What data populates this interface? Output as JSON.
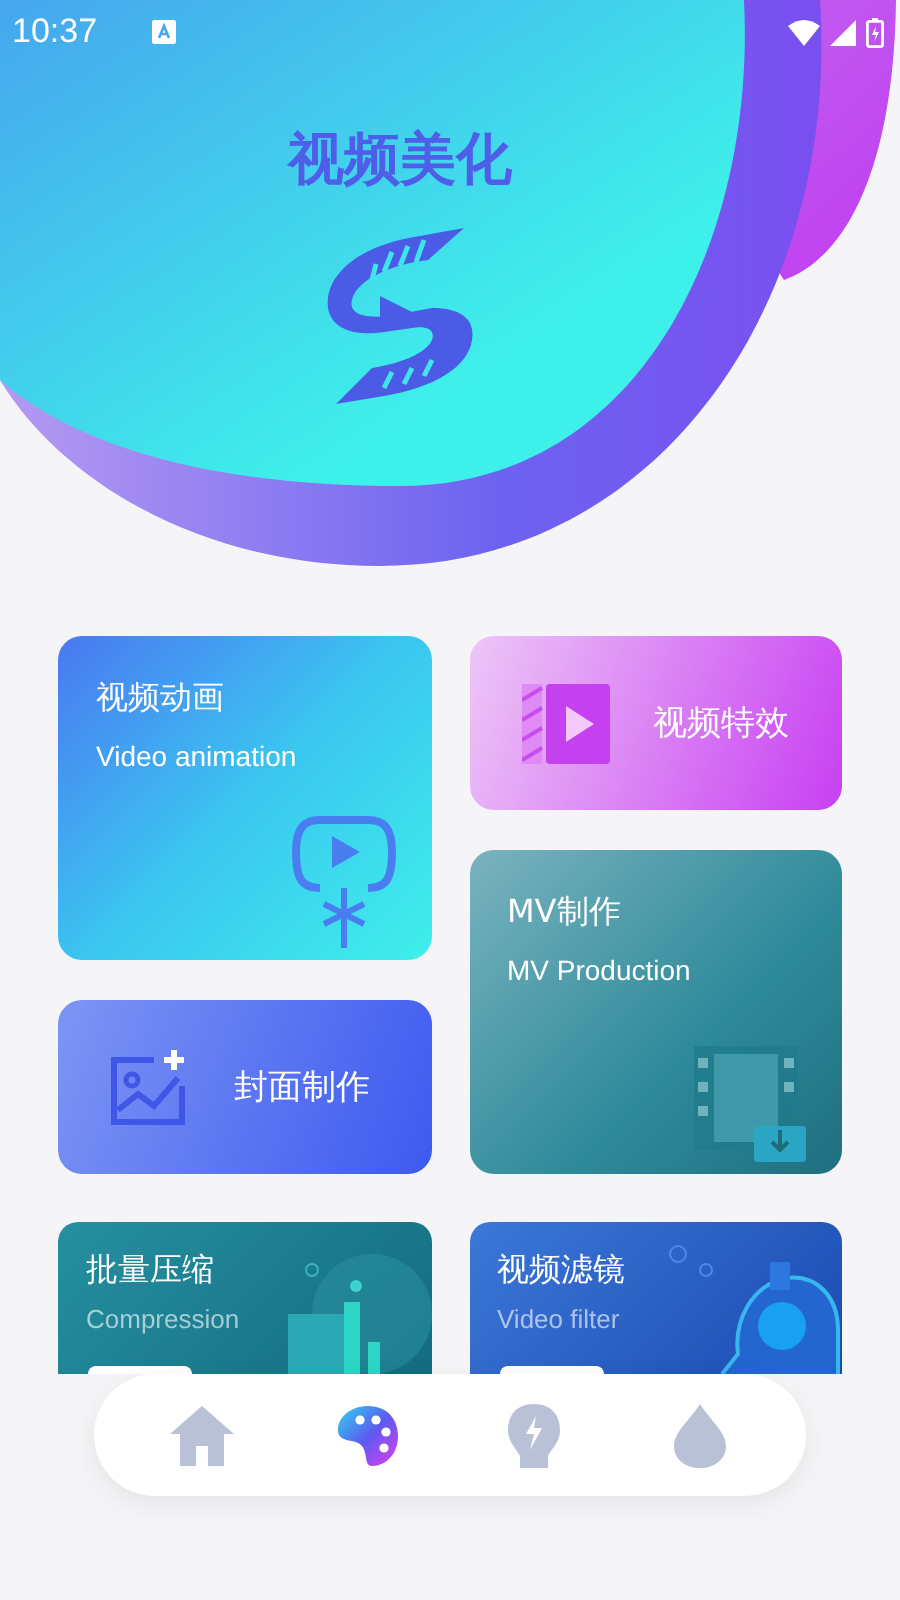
{
  "status_bar": {
    "time": "10:37"
  },
  "header": {
    "title": "视频美化"
  },
  "left_column": [
    {
      "kind": "text",
      "title": "视频动画",
      "subtitle": "Video animation"
    },
    {
      "kind": "icon",
      "title": "封面制作"
    }
  ],
  "right_column": [
    {
      "kind": "icon",
      "title": "视频特效"
    },
    {
      "kind": "text",
      "title": "MV制作",
      "subtitle": "MV Production"
    }
  ],
  "bottom_row": [
    {
      "title": "批量压缩",
      "subtitle": "Compression"
    },
    {
      "title": "视频滤镜",
      "subtitle": "Video filter"
    }
  ],
  "nav": [
    {
      "selected": false
    },
    {
      "selected": true
    },
    {
      "selected": false
    },
    {
      "selected": false
    }
  ]
}
